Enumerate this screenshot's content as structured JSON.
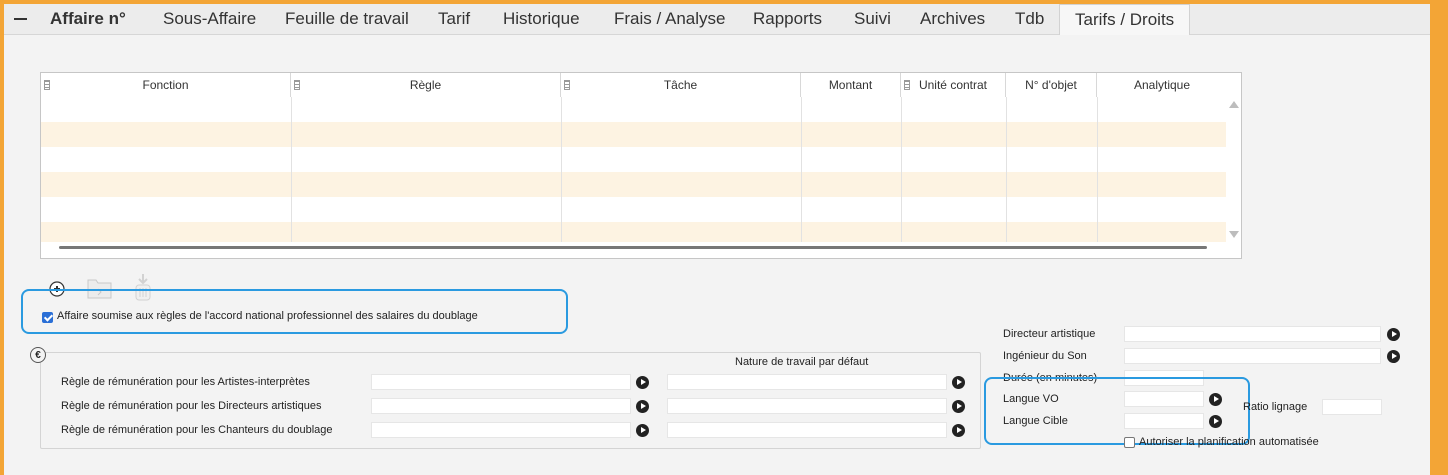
{
  "tabs": [
    {
      "label": "Affaire n°"
    },
    {
      "label": "Sous-Affaire"
    },
    {
      "label": "Feuille de travail"
    },
    {
      "label": "Tarif"
    },
    {
      "label": "Historique"
    },
    {
      "label": "Frais / Analyse"
    },
    {
      "label": "Rapports"
    },
    {
      "label": "Suivi"
    },
    {
      "label": "Archives"
    },
    {
      "label": "Tdb"
    },
    {
      "label": "Tarifs / Droits"
    }
  ],
  "active_tab": "Tarifs / Droits",
  "grid": {
    "columns": [
      "Fonction",
      "Règle",
      "Tâche",
      "Montant",
      "Unité contrat",
      "N° d'objet",
      "Analytique"
    ],
    "rows": []
  },
  "toolbar": {
    "add_icon": "add-circle-icon",
    "folder_icon": "folder-icon",
    "delete_icon": "trash-icon"
  },
  "agreement": {
    "checked": true,
    "label": "Affaire soumise aux règles de l'accord national professionnel des salaires du doublage"
  },
  "remuneration": {
    "euro_symbol": "€",
    "nature_header": "Nature de travail par défaut",
    "rows": [
      {
        "label": "Règle de rémunération pour les Artistes-interprètes",
        "value": "",
        "nature": ""
      },
      {
        "label": "Règle de rémunération pour les Directeurs artistiques",
        "value": "",
        "nature": ""
      },
      {
        "label": "Règle de rémunération pour les Chanteurs du doublage",
        "value": "",
        "nature": ""
      }
    ]
  },
  "right_form": {
    "directeur": {
      "label": "Directeur artistique",
      "value": ""
    },
    "ingenieur": {
      "label": "Ingénieur du Son",
      "value": ""
    },
    "duree": {
      "label": "Durée (en minutes)",
      "value": ""
    },
    "langue_vo": {
      "label": "Langue VO",
      "value": ""
    },
    "langue_cible": {
      "label": "Langue Cible",
      "value": ""
    },
    "ratio": {
      "label": "Ratio lignage",
      "value": ""
    },
    "planif": {
      "label": "Autoriser la planification automatisée",
      "checked": false
    }
  },
  "colors": {
    "accent": "#f3a536",
    "highlight": "#2a9ae0",
    "row_alt": "#fdf3e2"
  }
}
